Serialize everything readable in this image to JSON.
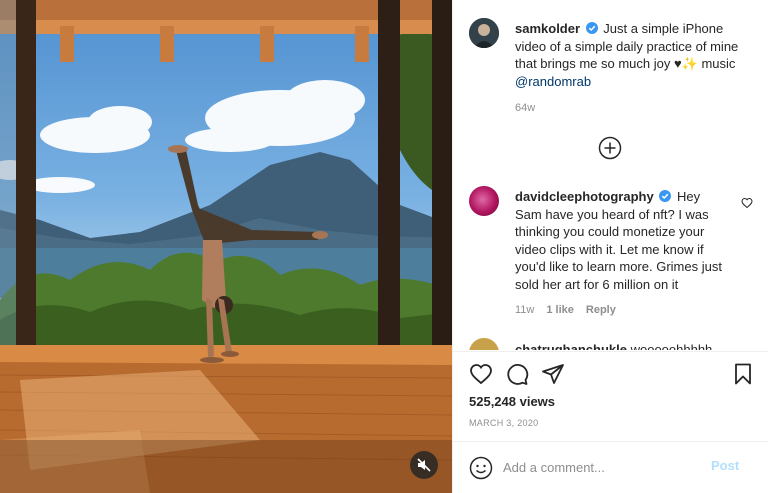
{
  "post": {
    "author": "samkolder",
    "caption_text": "Just a simple iPhone video of a simple daily practice of mine that brings me so much joy ♥✨ music ",
    "caption_mention": "@randomrab",
    "caption_age": "64w",
    "likes": "525,248 views",
    "date": "MARCH 3, 2020"
  },
  "comments": [
    {
      "user": "davidcleephotography",
      "text": "Hey Sam have you heard of nft? I was thinking you could monetize your video clips with it. Let me know if you'd like to learn more. Grimes just sold her art for 6 million on it",
      "age": "11w",
      "likes": "1 like",
      "reply_label": "Reply"
    },
    {
      "user_peek": "chatrughanchukle",
      "text_peek": "wooooohhhhh"
    }
  ],
  "composer": {
    "placeholder": "Add a comment...",
    "post_label": "Post"
  },
  "icons": {
    "verified": "verified-badge-icon",
    "load_more": "plus-circle-icon",
    "like": "heart-icon",
    "comment": "comment-bubble-icon",
    "share": "paper-plane-icon",
    "save": "bookmark-icon",
    "emoji": "smiley-icon",
    "mute": "speaker-muted-icon"
  },
  "colors": {
    "verified_blue": "#3897f0",
    "mention": "#00376b",
    "post_button_disabled": "#b2dffc",
    "muted_text": "#8e8e8e"
  }
}
